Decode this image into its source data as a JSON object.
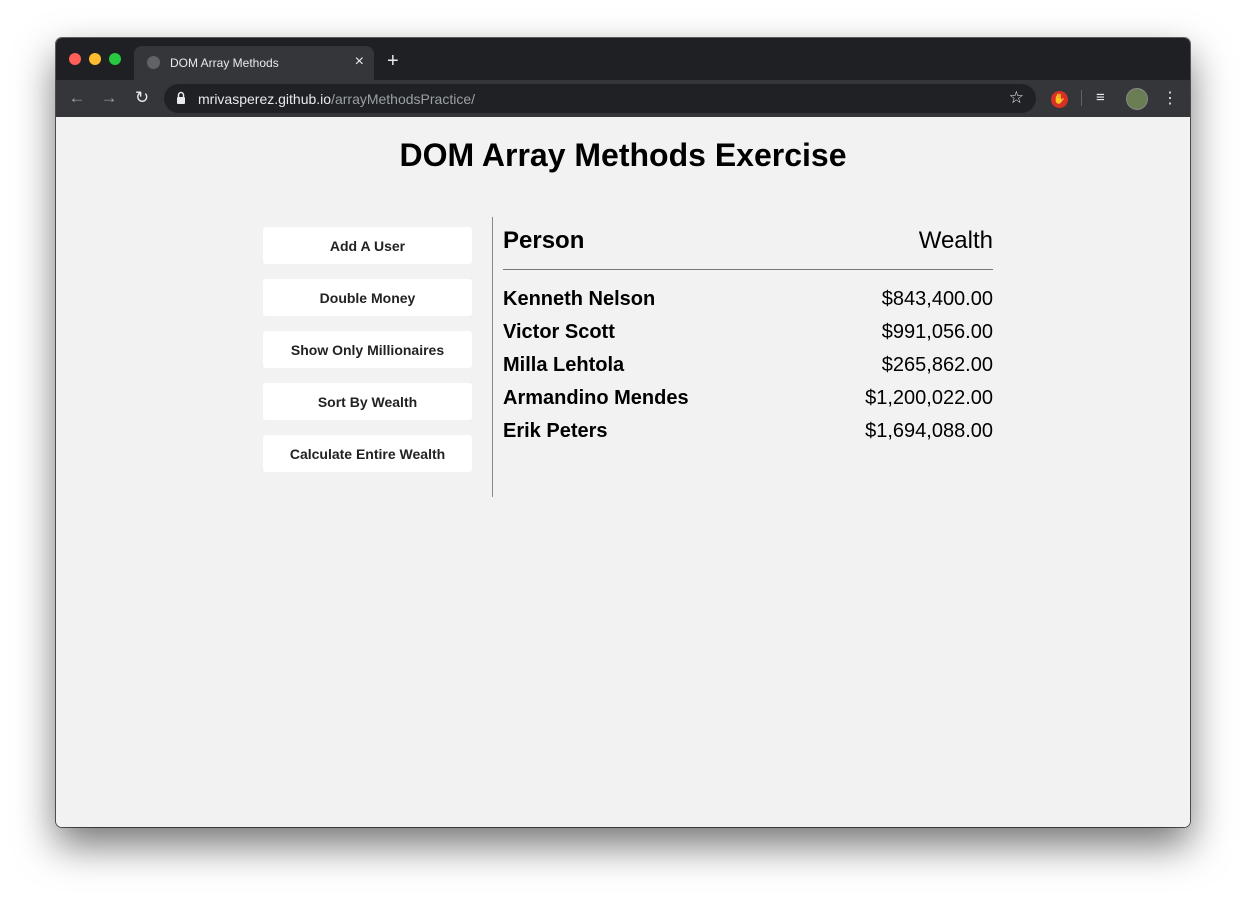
{
  "browser": {
    "tab_title": "DOM Array Methods",
    "tab_close": "×",
    "new_tab": "+",
    "url_host": "mrivasperez.github.io",
    "url_path": "/arrayMethodsPractice/"
  },
  "page": {
    "title": "DOM Array Methods Exercise",
    "actions": [
      {
        "label": "Add A User"
      },
      {
        "label": "Double Money"
      },
      {
        "label": "Show Only Millionaires"
      },
      {
        "label": "Sort By Wealth"
      },
      {
        "label": "Calculate Entire Wealth"
      }
    ],
    "table": {
      "header_person": "Person",
      "header_wealth": "Wealth",
      "rows": [
        {
          "name": "Kenneth Nelson",
          "wealth": "$843,400.00"
        },
        {
          "name": "Victor Scott",
          "wealth": "$991,056.00"
        },
        {
          "name": "Milla Lehtola",
          "wealth": "$265,862.00"
        },
        {
          "name": "Armandino Mendes",
          "wealth": "$1,200,022.00"
        },
        {
          "name": "Erik Peters",
          "wealth": "$1,694,088.00"
        }
      ]
    }
  },
  "colors": {
    "page_background": "#f2f2f2",
    "button_background": "#ffffff",
    "browser_chrome": "#35363a"
  }
}
